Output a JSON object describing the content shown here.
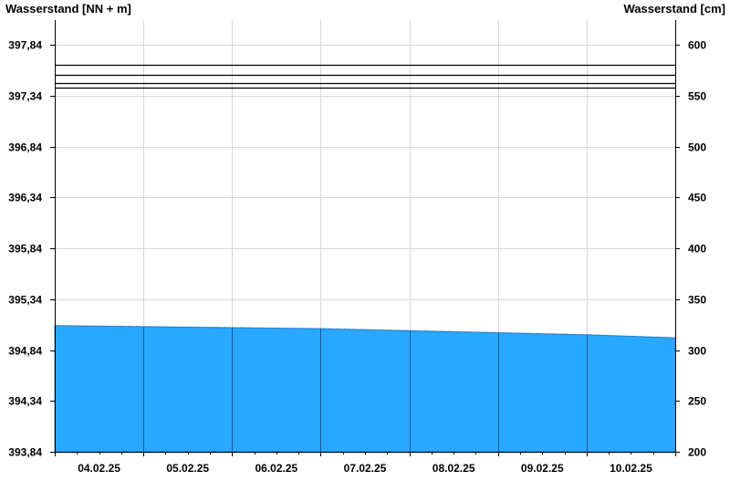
{
  "chart_data": {
    "type": "area",
    "left_axis": {
      "title": "Wasserstand [NN + m]",
      "ticks": [
        393.84,
        394.34,
        394.84,
        395.34,
        395.84,
        396.34,
        396.84,
        397.34,
        397.84
      ],
      "tick_labels": [
        "393,84",
        "394,34",
        "394,84",
        "395,34",
        "395,84",
        "396,34",
        "396,84",
        "397,34",
        "397,84"
      ],
      "range": [
        393.84,
        397.84
      ]
    },
    "right_axis": {
      "title": "Wasserstand [cm]",
      "ticks": [
        200,
        250,
        300,
        350,
        400,
        450,
        500,
        550,
        600
      ],
      "tick_labels": [
        "200",
        "250",
        "300",
        "350",
        "400",
        "450",
        "500",
        "550",
        "600"
      ],
      "range": [
        200,
        600
      ],
      "y_max_visible": 612
    },
    "x_axis": {
      "days": [
        "04.02.25",
        "05.02.25",
        "06.02.25",
        "07.02.25",
        "08.02.25",
        "09.02.25",
        "10.02.25"
      ],
      "grid": "day boundaries"
    },
    "reference_lines_cm": [
      580,
      570,
      562,
      558
    ],
    "series": [
      {
        "color": "#29a8ff",
        "x_days": [
          0,
          1,
          2,
          3,
          4,
          5,
          6,
          7
        ],
        "values_cm": [
          324,
          323,
          322,
          321,
          319,
          317,
          315,
          312
        ]
      }
    ],
    "grid": true,
    "colors": {
      "fill": "#29a8ff",
      "grid": "#d8d8d8",
      "axis": "#000000"
    }
  }
}
